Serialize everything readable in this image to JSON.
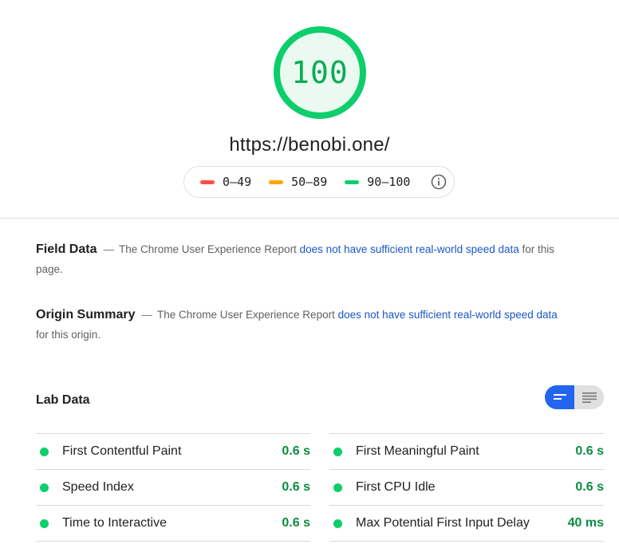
{
  "report": {
    "score": "100",
    "score_fraction": 1.0,
    "url": "https://benobi.one/",
    "colors": {
      "pass": "#0cce6b",
      "average": "#ffa400",
      "fail": "#ff4e42",
      "link": "#1a57c7",
      "toggle_active": "#2365ef"
    }
  },
  "legend": {
    "items": [
      {
        "range": "0–49",
        "color": "#ff4e42"
      },
      {
        "range": "50–89",
        "color": "#ffa400"
      },
      {
        "range": "90–100",
        "color": "#0cce6b"
      }
    ],
    "info_icon": "info-icon"
  },
  "field_data": {
    "title": "Field Data",
    "dash": "—",
    "text_before": "The Chrome User Experience Report ",
    "link_text": "does not have sufficient real-world speed data",
    "text_after": " for this page."
  },
  "origin_summary": {
    "title": "Origin Summary",
    "dash": "—",
    "text_before": "The Chrome User Experience Report ",
    "link_text": "does not have sufficient real-world speed data",
    "text_after": " for this origin."
  },
  "lab_data": {
    "title": "Lab Data",
    "toggle": {
      "active": "expanded-view",
      "icons": [
        "compact-view-icon",
        "expanded-view-icon"
      ]
    },
    "metrics_left": [
      {
        "name": "First Contentful Paint",
        "value": "0.6 s"
      },
      {
        "name": "Speed Index",
        "value": "0.6 s"
      },
      {
        "name": "Time to Interactive",
        "value": "0.6 s"
      }
    ],
    "metrics_right": [
      {
        "name": "First Meaningful Paint",
        "value": "0.6 s"
      },
      {
        "name": "First CPU Idle",
        "value": "0.6 s"
      },
      {
        "name": "Max Potential First Input Delay",
        "value": "40 ms"
      }
    ]
  }
}
